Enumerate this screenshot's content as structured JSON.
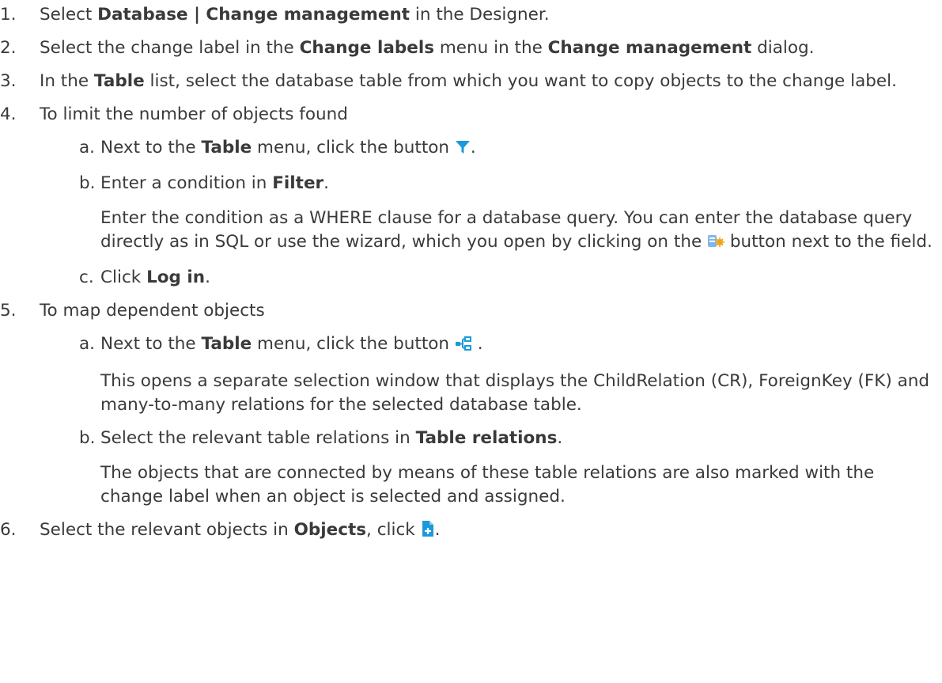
{
  "steps": [
    {
      "num": "1.",
      "pre": "Select ",
      "b1": "Database | Change management",
      "post": " in the Designer."
    },
    {
      "num": "2.",
      "pre": "Select the change label in the ",
      "b1": "Change labels",
      "mid": " menu in the ",
      "b2": "Change management",
      "post": " dialog."
    },
    {
      "num": "3.",
      "pre": "In the ",
      "b1": "Table",
      "post": " list, select the database table from which you want to copy objects to the change label."
    },
    {
      "num": "4.",
      "text": "To limit the number of objects found",
      "subs": [
        {
          "letter": "a.",
          "pre": "Next to the ",
          "b1": "Table",
          "post": " menu, click the button ",
          "icon": "filter-icon",
          "end": "."
        },
        {
          "letter": "b.",
          "pre": "Enter a condition in ",
          "b1": "Filter",
          "post": ".",
          "note_pre": "Enter the condition as a WHERE clause for a database query. You can enter the database query directly as in SQL or use the wizard, which you open by clicking on the ",
          "note_icon": "query-wizard-icon",
          "note_post": " button next to the field."
        },
        {
          "letter": "c.",
          "pre": "Click ",
          "b1": "Log in",
          "post": "."
        }
      ]
    },
    {
      "num": "5.",
      "text": "To map dependent objects",
      "subs": [
        {
          "letter": "a.",
          "pre": "Next to the ",
          "b1": "Table",
          "post": " menu, click the button ",
          "icon": "relations-icon",
          "end": " .",
          "note": "This opens a separate selection window that displays the ChildRelation (CR), ForeignKey (FK) and many-to-many relations for the selected database table."
        },
        {
          "letter": "b.",
          "pre": "Select the relevant table relations in ",
          "b1": "Table relations",
          "post": ".",
          "note": "The objects that are connected by means of these table relations are also marked with the change label when an object is selected and assigned."
        }
      ]
    },
    {
      "num": "6.",
      "pre": "Select the relevant objects in ",
      "b1": "Objects",
      "post": ", click ",
      "icon": "add-icon",
      "end": "."
    }
  ],
  "colors": {
    "text": "#3a3a3a",
    "icon_blue": "#1a9ad9"
  }
}
